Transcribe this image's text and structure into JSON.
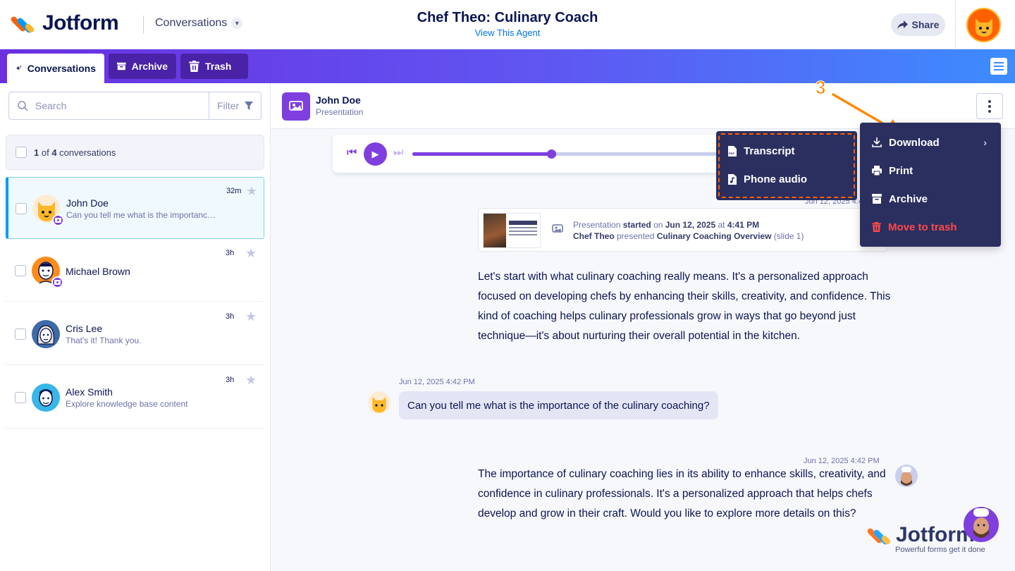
{
  "header": {
    "logo": "Jotform",
    "section_dropdown": "Conversations",
    "agent_title": "Chef Theo: Culinary Coach",
    "agent_link": "View This Agent",
    "share_label": "Share"
  },
  "tabs": [
    {
      "label": "Conversations",
      "icon": "sparkle-icon",
      "active": true
    },
    {
      "label": "Archive",
      "icon": "archive-icon",
      "active": false
    },
    {
      "label": "Trash",
      "icon": "trash-icon",
      "active": false
    }
  ],
  "sidebar": {
    "search_placeholder": "Search",
    "filter_label": "Filter",
    "count_selected": "1",
    "count_of": " of ",
    "count_total": "4",
    "count_suffix": " conversations",
    "conversations": [
      {
        "name": "John Doe",
        "preview": "Can you tell me what is the importance of the culinary coaching?",
        "time": "32m",
        "selected": true,
        "badge": true
      },
      {
        "name": "Michael Brown",
        "preview": "",
        "time": "3h",
        "selected": false,
        "badge": true
      },
      {
        "name": "Cris Lee",
        "preview": "That's it! Thank you.",
        "time": "3h",
        "selected": false,
        "badge": false
      },
      {
        "name": "Alex Smith",
        "preview": "Explore knowledge base content",
        "time": "3h",
        "selected": false,
        "badge": false
      }
    ]
  },
  "conversation": {
    "name": "John Doe",
    "type": "Presentation",
    "player_progress": 0.41,
    "presentation_time": "Jun 12, 2025 4:41 PM",
    "presentation_card": {
      "prefix": "Presentation ",
      "started": "started",
      "on": " on ",
      "date": "Jun 12, 2025",
      "at": " at ",
      "time": "4:41 PM",
      "presenter": "Chef Theo",
      "presented": " presented ",
      "deck": "Culinary Coaching Overview",
      "slide": " (slide 1)"
    },
    "agent_msg_1": "Let's start with what culinary coaching really means. It's a personalized approach focused on developing chefs by enhancing their skills, creativity, and confidence. This kind of coaching helps culinary professionals grow in ways that go beyond just technique—it's about nurturing their overall potential in the kitchen.",
    "user_msg_time": "Jun 12, 2025 4:42 PM",
    "user_msg": "Can you tell me what is the importance of the culinary coaching?",
    "agent_msg_2_time": "Jun 12, 2025 4:42 PM",
    "agent_msg_2": "The importance of culinary coaching lies in its ability to enhance skills, creativity, and confidence in culinary professionals. It's a personalized approach that helps chefs develop and grow in their craft. Would you like to explore more details on this?"
  },
  "menu": {
    "items": [
      {
        "label": "Download",
        "icon": "download-icon",
        "has_submenu": true
      },
      {
        "label": "Print",
        "icon": "print-icon"
      },
      {
        "label": "Archive",
        "icon": "archive-icon"
      },
      {
        "label": "Move to trash",
        "icon": "trash-icon",
        "danger": true
      }
    ],
    "submenu": [
      {
        "label": "Transcript",
        "icon": "pdf-file-icon"
      },
      {
        "label": "Phone audio",
        "icon": "audio-file-icon"
      }
    ]
  },
  "annotation_step": "3",
  "watermark": {
    "name": "Jotform",
    "tagline": "Powerful forms get it done"
  },
  "colors": {
    "accent": "#7e3fde",
    "brand_orange": "#ff6100",
    "menu_bg": "#2b2f5f",
    "danger": "#ff4948",
    "link": "#0075e3"
  }
}
